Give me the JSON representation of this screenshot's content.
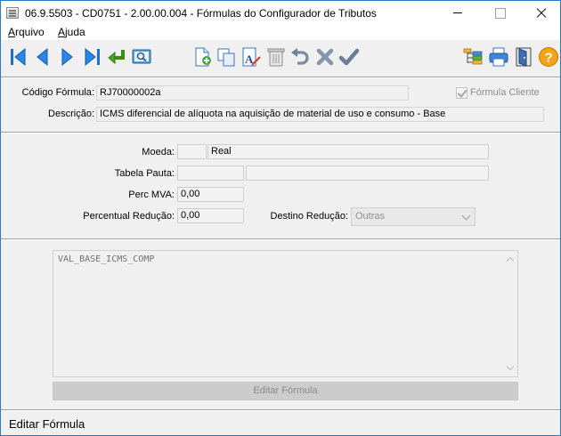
{
  "window": {
    "title": "06.9.5503 - CD0751 - 2.00.00.004 - Fórmulas do Configurador de Tributos"
  },
  "menu": {
    "items": [
      {
        "label": "Arquivo",
        "accel": "A",
        "rest": "rquivo"
      },
      {
        "label": "Ajuda",
        "accel": "A",
        "rest": "juda"
      }
    ]
  },
  "toolbar": {
    "icons": [
      "first-record-icon",
      "previous-record-icon",
      "next-record-icon",
      "last-record-icon",
      "select-return-icon",
      "search-icon",
      "new-record-icon",
      "copy-record-icon",
      "edit-record-icon",
      "delete-record-icon",
      "undo-icon",
      "cancel-icon",
      "confirm-icon",
      "tree-structure-icon",
      "print-icon",
      "exit-icon",
      "help-icon"
    ]
  },
  "header": {
    "codigo_label": "Código Fórmula:",
    "codigo_value": "RJ70000002a",
    "formula_cliente_label": "Fórmula Cliente",
    "formula_cliente_checked": true,
    "descricao_label": "Descrição:",
    "descricao_value": "ICMS diferencial de alíquota na aquisição de material de uso e consumo - Base"
  },
  "params": {
    "moeda_label": "Moeda:",
    "moeda_code": "",
    "moeda_value": "Real",
    "tabela_label": "Tabela Pauta:",
    "tabela_code": "",
    "tabela_value": "",
    "perc_mva_label": "Perc MVA:",
    "perc_mva_value": "0,00",
    "perc_reducao_label": "Percentual Redução:",
    "perc_reducao_value": "0,00",
    "destino_label": "Destino Redução:",
    "destino_value": "Outras"
  },
  "formula": {
    "text": "VAL_BASE_ICMS_COMP",
    "edit_button_label": "Editar Fórmula"
  },
  "status": {
    "text": "Editar Fórmula"
  }
}
